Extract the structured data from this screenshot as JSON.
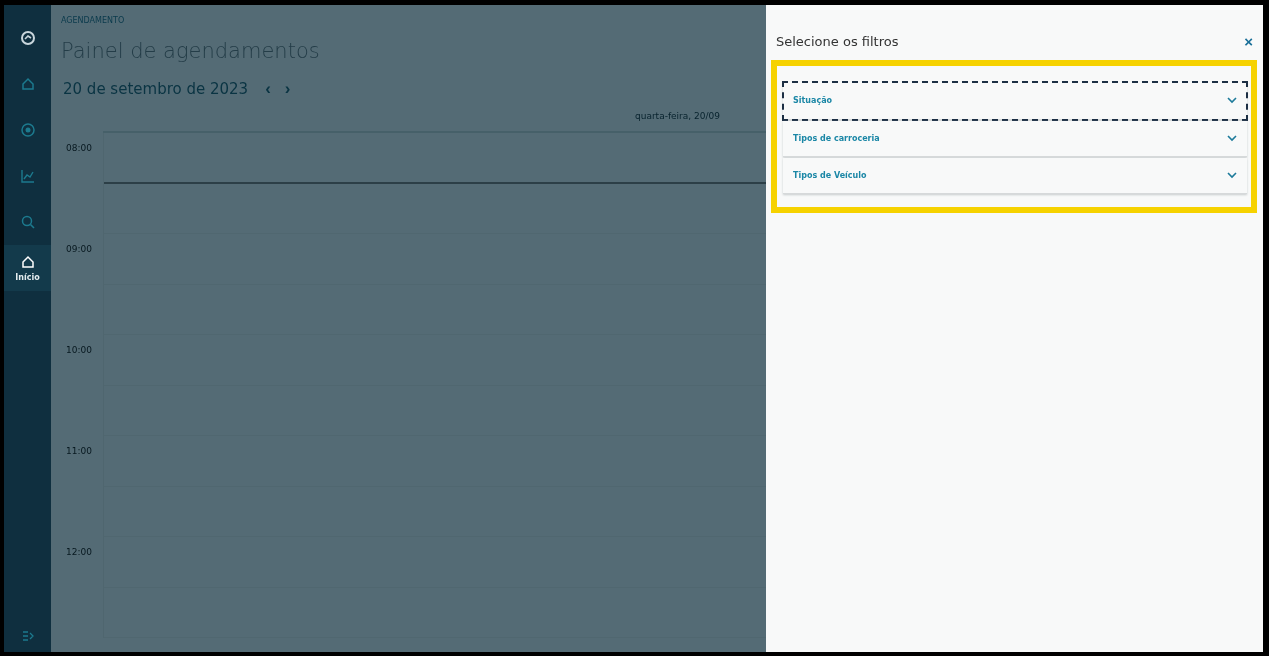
{
  "sidebar": {
    "items": [
      {
        "kind": "logo",
        "selected": false
      },
      {
        "kind": "home",
        "selected": false
      },
      {
        "kind": "target",
        "selected": false
      },
      {
        "kind": "chart",
        "selected": false
      },
      {
        "kind": "search",
        "selected": false
      },
      {
        "kind": "home",
        "label": "Início",
        "selected": true
      }
    ],
    "footer_items": [
      {
        "kind": "exit"
      }
    ]
  },
  "breadcrumb": "AGENDAMENTO",
  "page_title": "Painel de agendamentos",
  "date": "20 de setembro de 2023",
  "date_nav": [
    "‹",
    "›"
  ],
  "calendar": {
    "day_header": "quarta-feira, 20/09",
    "hours": [
      "08:00",
      "09:00",
      "10:00",
      "11:00",
      "12:00"
    ]
  },
  "filter_panel": {
    "title": "Selecione os filtros",
    "close": "×",
    "highlighted": true,
    "filters": [
      {
        "label": "Situação",
        "focused": true
      },
      {
        "label": "Tipos de carroceria",
        "focused": false
      },
      {
        "label": "Tipos de Veículo",
        "focused": false
      }
    ]
  }
}
